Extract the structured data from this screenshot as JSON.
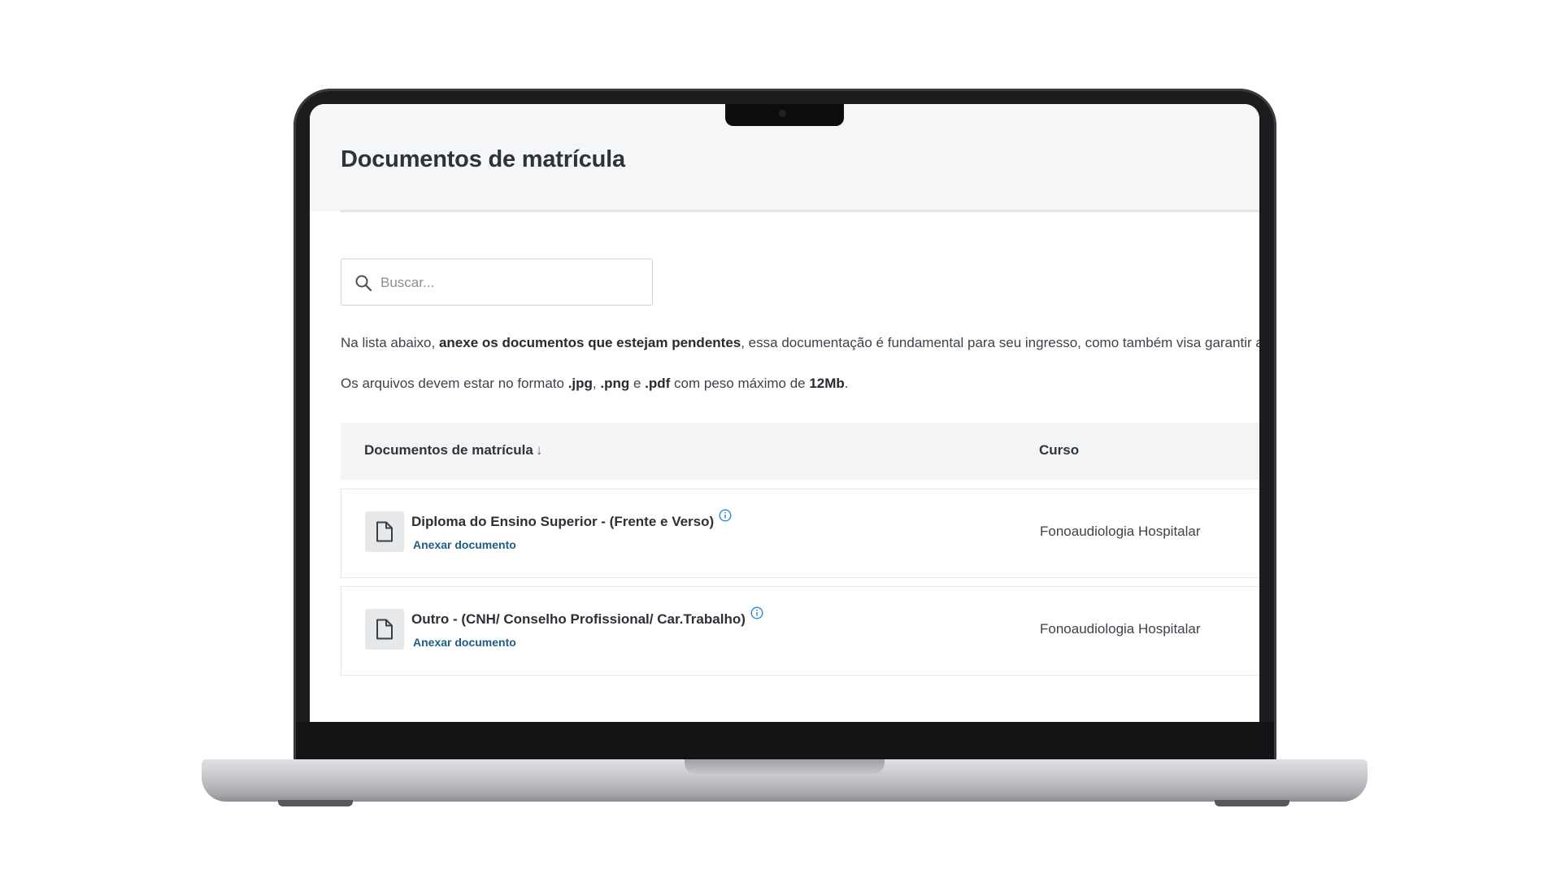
{
  "page": {
    "title": "Documentos de matrícula"
  },
  "search": {
    "placeholder": "Buscar..."
  },
  "info": {
    "line1_prefix": "Na lista abaixo, ",
    "line1_bold": "anexe os documentos que estejam pendentes",
    "line1_suffix": ", essa documentação é fundamental para seu ingresso, como também visa garantir a e",
    "line2_prefix": "Os arquivos devem estar no formato ",
    "line2_fmt1": ".jpg",
    "line2_sep1": ", ",
    "line2_fmt2": ".png",
    "line2_sep2": " e ",
    "line2_fmt3": ".pdf",
    "line2_mid": " com peso máximo de ",
    "line2_size": "12Mb",
    "line2_end": "."
  },
  "table": {
    "col_documents": "Documentos de matrícula",
    "sort_indicator": "↓",
    "col_course": "Curso",
    "rows": [
      {
        "title": "Diploma do Ensino Superior - (Frente e Verso)",
        "action": "Anexar documento",
        "course": "Fonoaudiologia Hospitalar"
      },
      {
        "title": "Outro - (CNH/ Conselho Profissional/ Car.Trabalho)",
        "action": "Anexar documento",
        "course": "Fonoaudiologia Hospitalar"
      }
    ]
  },
  "icons": {
    "search": "search-icon",
    "document": "document-icon",
    "info": "info-icon"
  },
  "colors": {
    "link": "#1f5d83",
    "info_icon": "#2a8bd0"
  }
}
